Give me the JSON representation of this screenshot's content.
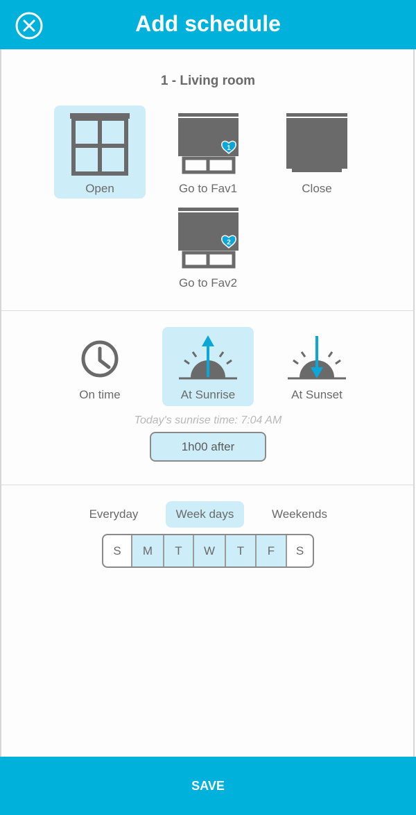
{
  "header": {
    "title": "Add schedule",
    "close_icon": "close-circle-icon"
  },
  "room": {
    "title": "1 - Living room"
  },
  "actions": [
    {
      "label": "Open",
      "icon": "window-open-icon",
      "selected": true
    },
    {
      "label": "Go to Fav1",
      "icon": "favorite-1-icon",
      "badge": "1",
      "selected": false
    },
    {
      "label": "Close",
      "icon": "window-closed-icon",
      "selected": false
    },
    {
      "label": "Go to Fav2",
      "icon": "favorite-2-icon",
      "badge": "2",
      "selected": false
    }
  ],
  "triggers": [
    {
      "label": "On time",
      "icon": "clock-icon",
      "selected": false
    },
    {
      "label": "At Sunrise",
      "icon": "sunrise-icon",
      "selected": true
    },
    {
      "label": "At Sunset",
      "icon": "sunset-icon",
      "selected": false
    }
  ],
  "sunrise_note": "Today's sunrise time: 7:04 AM",
  "offset_label": "1h00 after",
  "frequency": [
    {
      "label": "Everyday",
      "selected": false
    },
    {
      "label": "Week days",
      "selected": true
    },
    {
      "label": "Weekends",
      "selected": false
    }
  ],
  "days": [
    {
      "label": "S",
      "on": false
    },
    {
      "label": "M",
      "on": true
    },
    {
      "label": "T",
      "on": true
    },
    {
      "label": "W",
      "on": true
    },
    {
      "label": "T",
      "on": true
    },
    {
      "label": "F",
      "on": true
    },
    {
      "label": "S",
      "on": false
    }
  ],
  "save_label": "SAVE",
  "colors": {
    "accent": "#00b1dc",
    "selected_bg": "#cdeef8",
    "icon_gray": "#6a6a6a",
    "icon_blue": "#0aa7d8"
  }
}
